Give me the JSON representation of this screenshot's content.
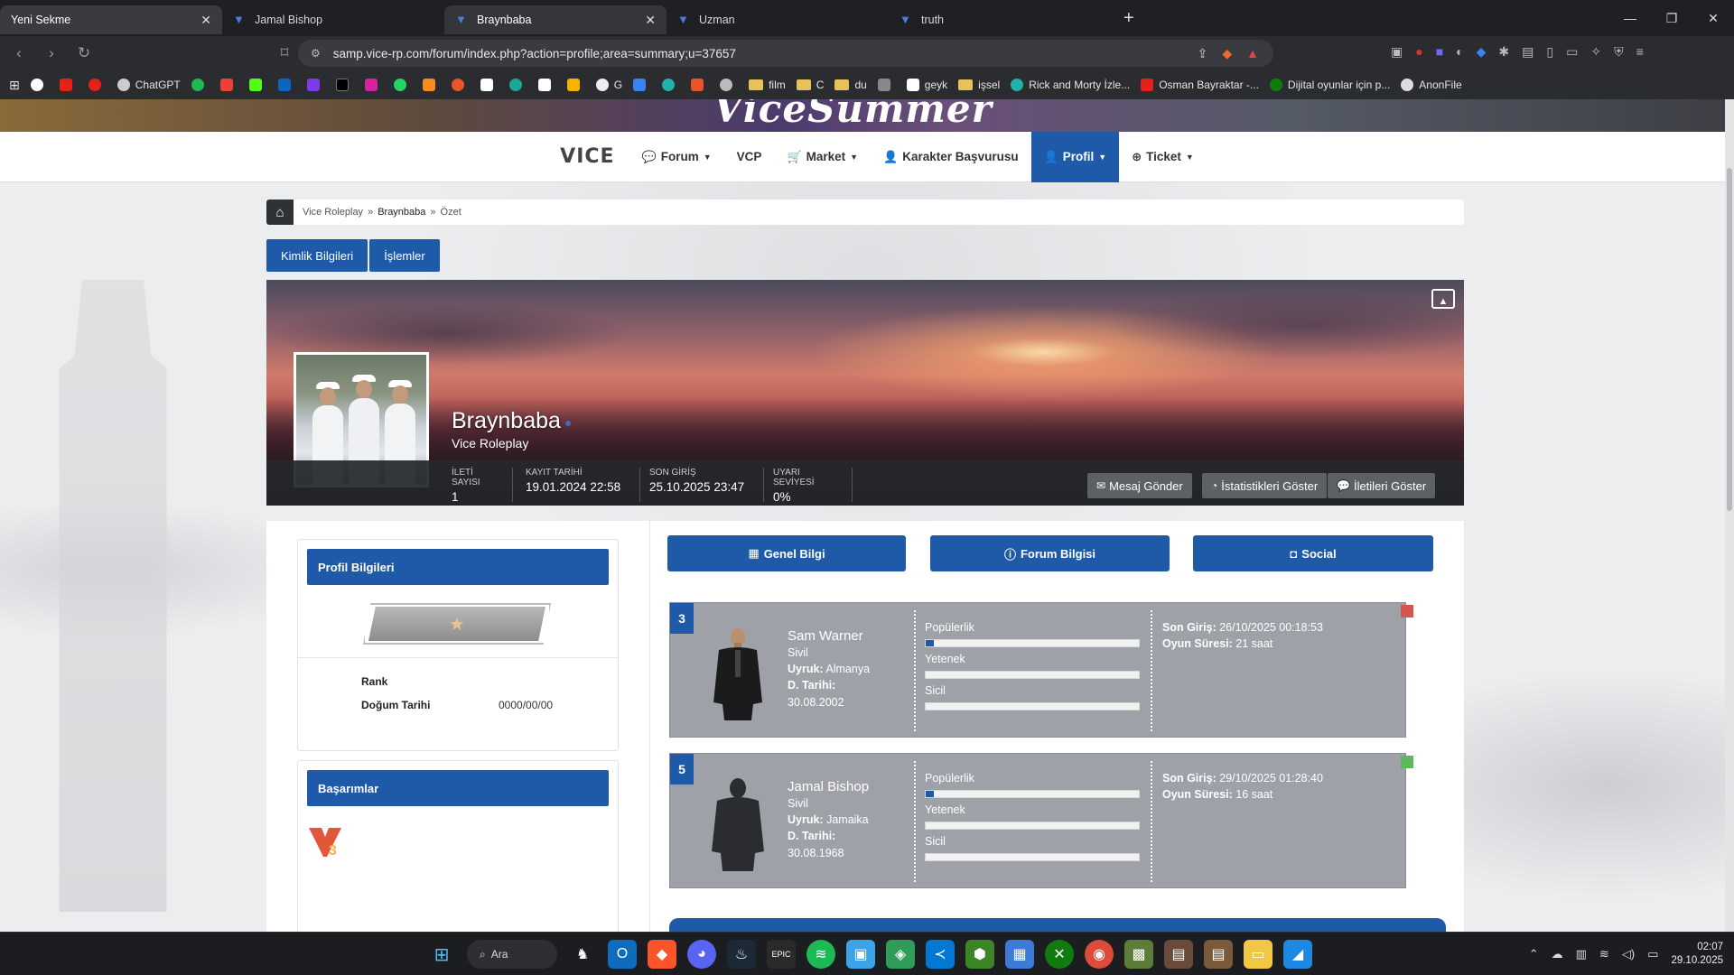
{
  "browser": {
    "tabs": [
      {
        "title": "Yeni Sekme",
        "state": "first"
      },
      {
        "title": "Jamal Bishop",
        "state": "normal"
      },
      {
        "title": "Braynbaba",
        "state": "active"
      },
      {
        "title": "Uzman",
        "state": "normal"
      },
      {
        "title": "truth",
        "state": "normal"
      }
    ],
    "url": "samp.vice-rp.com/forum/index.php?action=profile;area=summary;u=37657",
    "bookmarks": [
      "ChatGPT",
      "G",
      "film",
      "C",
      "du",
      "geyk",
      "işsel",
      "Rick and Morty İzle...",
      "Osman Bayraktar -...",
      "Dijital oyunlar için p...",
      "AnonFile"
    ]
  },
  "site": {
    "brand": "VICE",
    "nav": [
      {
        "label": "Forum",
        "icon": "comments-icon",
        "caret": true
      },
      {
        "label": "VCP",
        "icon": "",
        "caret": false
      },
      {
        "label": "Market",
        "icon": "cart-icon",
        "caret": true
      },
      {
        "label": "Karakter Başvurusu",
        "icon": "user-plus-icon",
        "caret": false
      },
      {
        "label": "Profil",
        "icon": "user-icon",
        "caret": true,
        "active": true
      },
      {
        "label": "Ticket",
        "icon": "lifebuoy-icon",
        "caret": true
      }
    ],
    "breadcrumb": [
      "Vice Roleplay",
      "Braynbaba",
      "Özet"
    ],
    "subtabs": [
      "Kimlik Bilgileri",
      "İşlemler"
    ]
  },
  "profile": {
    "username": "Braynbaba",
    "group": "Vice Roleplay",
    "stats": [
      {
        "label": "İLETİ SAYISI",
        "value": "1"
      },
      {
        "label": "KAYIT TARİHİ",
        "value": "19.01.2024 22:58"
      },
      {
        "label": "SON GİRİŞ",
        "value": "25.10.2025 23:47"
      },
      {
        "label": "UYARI SEVİYESİ",
        "value": "0%"
      }
    ],
    "actions": [
      "Mesaj Gönder",
      "İstatistikleri Göster",
      "İletileri Göster"
    ]
  },
  "profile_info": {
    "title": "Profil Bilgileri",
    "rank_label": "Rank",
    "rank_value": "",
    "dob_label": "Doğum Tarihi",
    "dob_value": "0000/00/00"
  },
  "achievements": {
    "title": "Başarımlar"
  },
  "content_tabs": [
    "Genel Bilgi",
    "Forum Bilgisi",
    "Social"
  ],
  "characters": [
    {
      "number": "3",
      "name": "Sam Warner",
      "job": "Sivil",
      "nationality_label": "Uyruk:",
      "nationality": "Almanya",
      "dob_label": "D. Tarihi:",
      "dob": "30.08.2002",
      "bars": [
        {
          "label": "Popülerlik",
          "fraction": 0.04
        },
        {
          "label": "Yetenek",
          "fraction": 0
        },
        {
          "label": "Sicil",
          "fraction": 0
        }
      ],
      "last_login_label": "Son Giriş:",
      "last_login": "26/10/2025 00:18:53",
      "playtime_label": "Oyun Süresi:",
      "playtime": "21 saat",
      "status_color": "#d9534f"
    },
    {
      "number": "5",
      "name": "Jamal Bishop",
      "job": "Sivil",
      "nationality_label": "Uyruk:",
      "nationality": "Jamaika",
      "dob_label": "D. Tarihi:",
      "dob": "30.08.1968",
      "bars": [
        {
          "label": "Popülerlik",
          "fraction": 0.04
        },
        {
          "label": "Yetenek",
          "fraction": 0
        },
        {
          "label": "Sicil",
          "fraction": 0
        }
      ],
      "last_login_label": "Son Giriş:",
      "last_login": "29/10/2025 01:28:40",
      "playtime_label": "Oyun Süresi:",
      "playtime": "16 saat",
      "status_color": "#5cb85c"
    }
  ],
  "taskbar": {
    "search_label": "Ara",
    "time": "02:07",
    "date": "29.10.2025"
  },
  "colors": {
    "accent": "#1e5aa8",
    "card": "#9ea2a8"
  }
}
